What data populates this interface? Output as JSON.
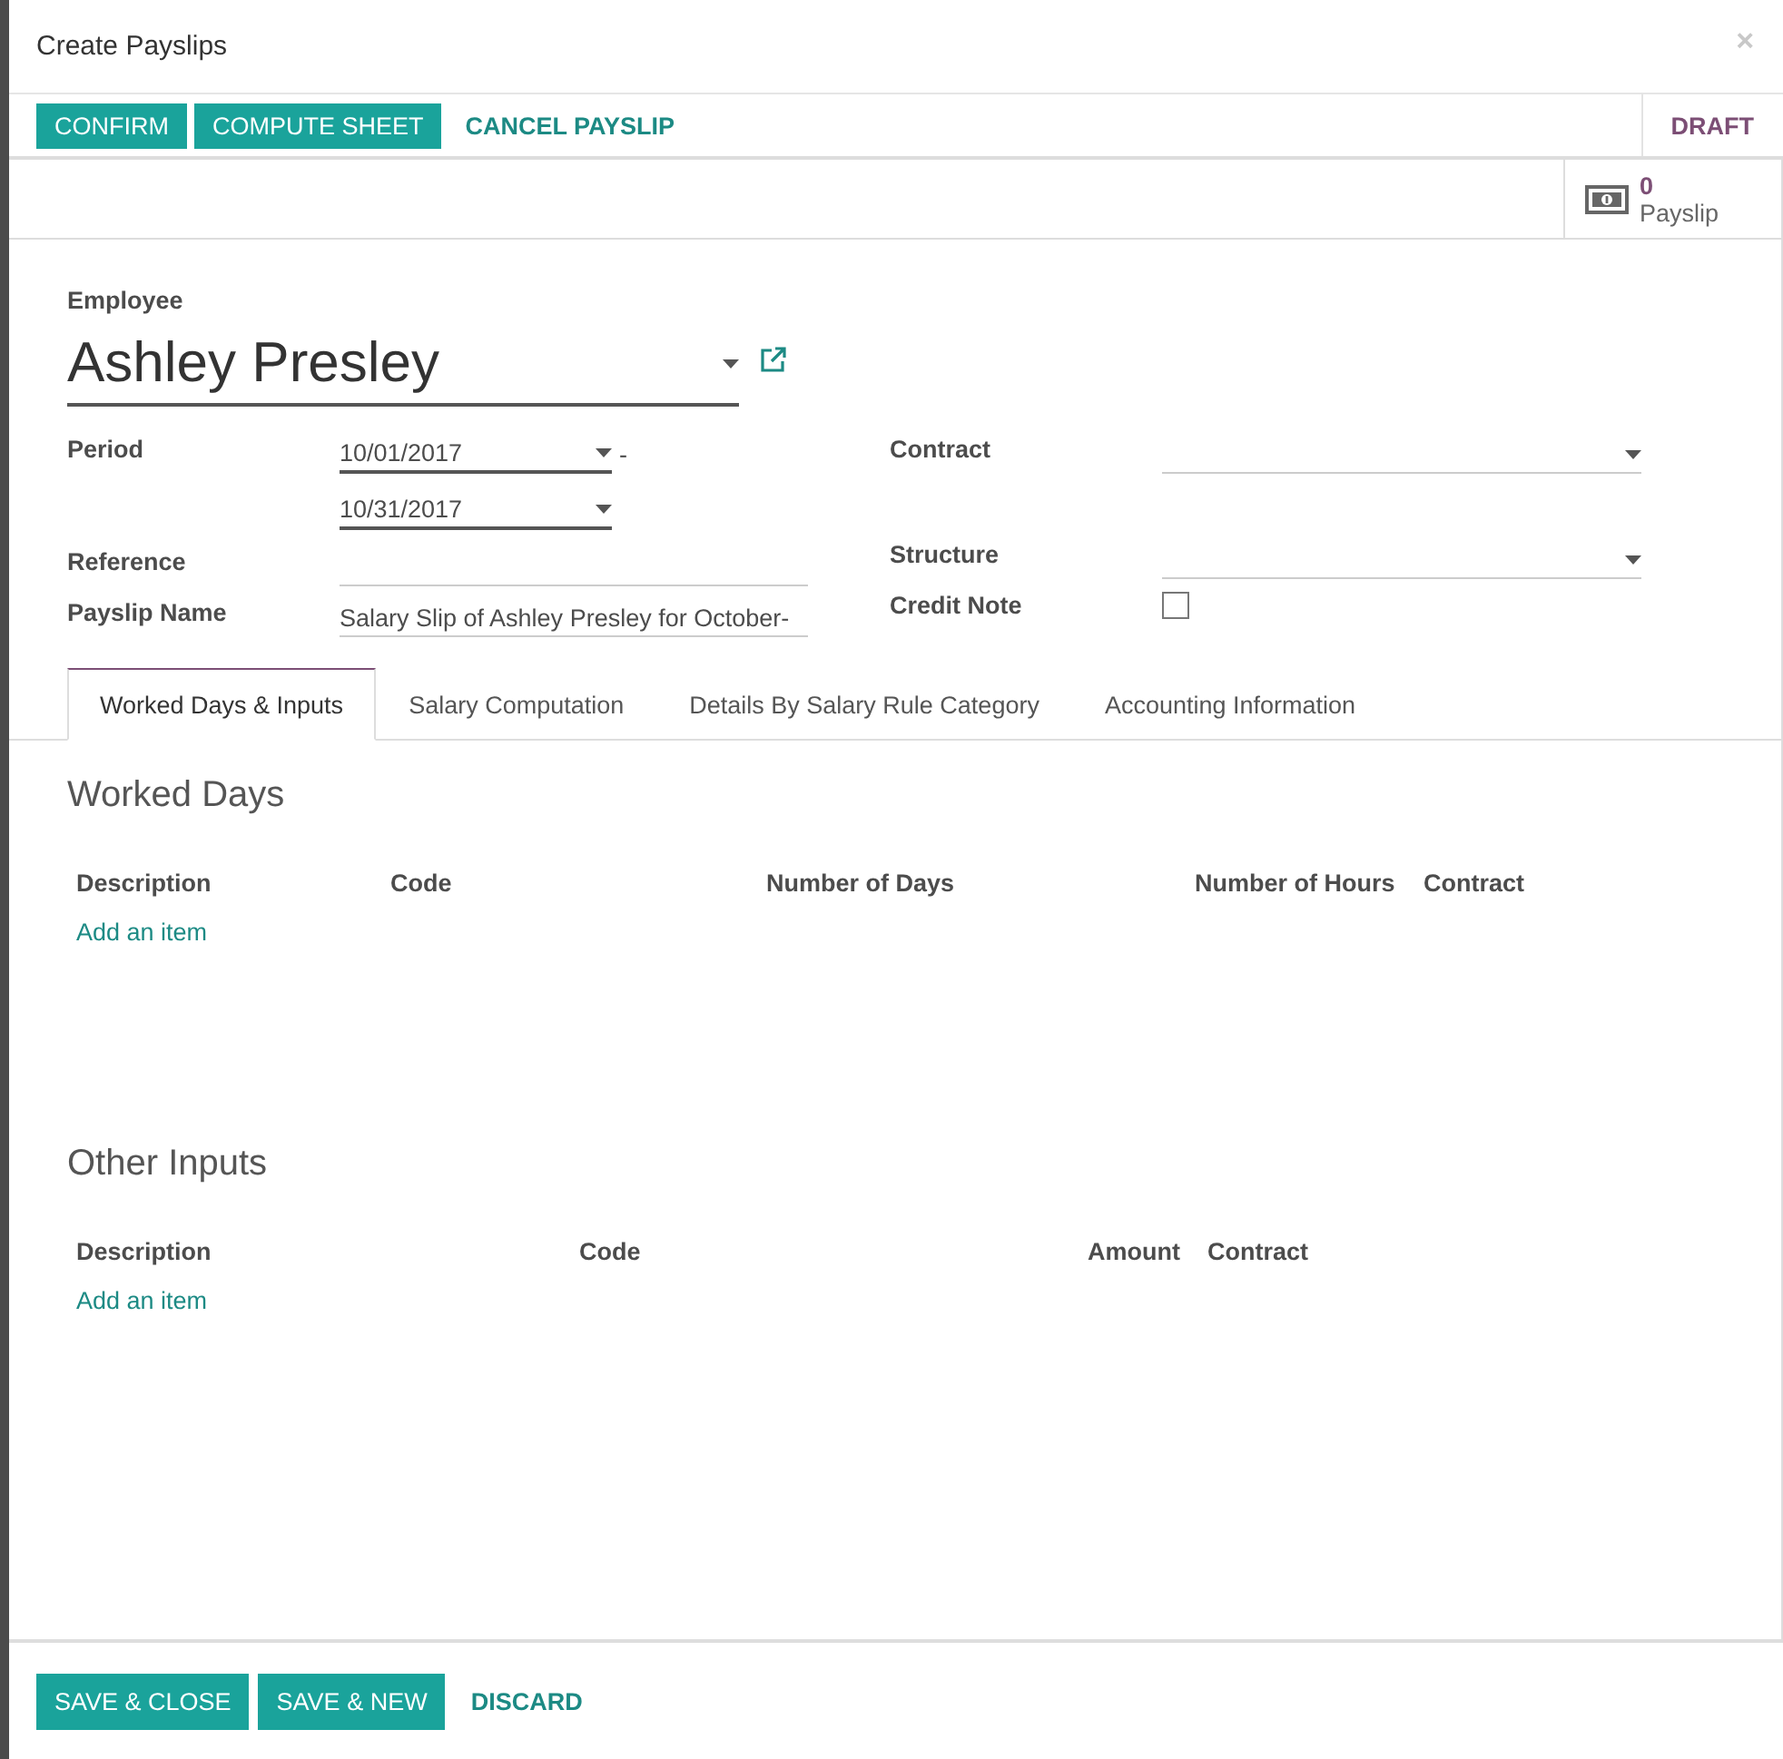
{
  "window": {
    "title": "Create Payslips",
    "close": "×"
  },
  "actions": [
    {
      "label": "CONFIRM",
      "kind": "primary"
    },
    {
      "label": "COMPUTE SHEET",
      "kind": "primary"
    },
    {
      "label": "CANCEL PAYSLIP",
      "kind": "link"
    }
  ],
  "status": "DRAFT",
  "stat_button": {
    "count": "0",
    "label": "Payslip"
  },
  "employee": {
    "label": "Employee",
    "value": "Ashley Presley"
  },
  "left_fields": [
    {
      "label": "Period",
      "kind": "daterange",
      "from": "10/01/2017",
      "separator": "-",
      "to": "10/31/2017"
    },
    {
      "label": "Reference",
      "kind": "text"
    },
    {
      "label": "Payslip Name",
      "kind": "text",
      "value": "Salary Slip of Ashley Presley for October-"
    }
  ],
  "right_fields": [
    {
      "label": "Contract",
      "kind": "select"
    },
    {
      "label": "Structure",
      "kind": "select"
    },
    {
      "label": "Credit Note",
      "kind": "checkbox",
      "checked": false
    }
  ],
  "tabs": [
    {
      "label": "Worked Days & Inputs",
      "selected": true
    },
    {
      "label": "Salary Computation",
      "selected": false
    },
    {
      "label": "Details By Salary Rule Category",
      "selected": false
    },
    {
      "label": "Accounting Information",
      "selected": false
    }
  ],
  "sections": [
    {
      "title": "Worked Days",
      "columns": [
        "Description",
        "Code",
        "Number of Days",
        "Number of Hours",
        "Contract"
      ],
      "add_item": "Add an item"
    },
    {
      "title": "Other Inputs",
      "columns": [
        "Description",
        "Code",
        "Amount",
        "Contract"
      ],
      "add_item": "Add an item"
    }
  ],
  "footer": [
    {
      "label": "SAVE & CLOSE",
      "kind": "primary"
    },
    {
      "label": "SAVE & NEW",
      "kind": "primary"
    },
    {
      "label": "DISCARD",
      "kind": "link"
    }
  ]
}
